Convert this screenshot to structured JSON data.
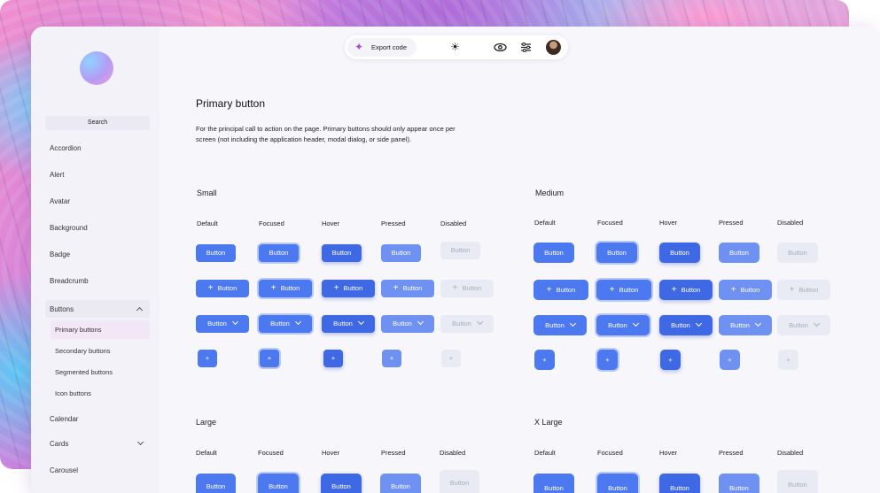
{
  "toolbar": {
    "export_label": "Export code",
    "icons": [
      "sparkle-icon",
      "sun-icon",
      "eye-icon",
      "sliders-icon",
      "avatar"
    ]
  },
  "sidebar": {
    "search_label": "Search",
    "items": [
      "Accordion",
      "Alert",
      "Avatar",
      "Background",
      "Badge",
      "Breadcrumb"
    ],
    "group_label": "Buttons",
    "sub_items": [
      "Primary buttons",
      "Secondary buttons",
      "Segmented buttons",
      "Icon buttons"
    ],
    "after_items": [
      "Calendar",
      "Cards",
      "Carousel"
    ]
  },
  "main": {
    "title": "Primary button",
    "description": "For the principal call to action on the page. Primary buttons should only appear once per screen (not including the application header, modal dialog, or side panel).",
    "states": [
      "Default",
      "Focused",
      "Hover",
      "Pressed",
      "Disabled"
    ],
    "sections": {
      "small": "Small",
      "medium": "Medium",
      "large": "Large",
      "xlarge": "X Large"
    },
    "button_label": "Button",
    "plus_glyph": "+"
  },
  "colors": {
    "primary": "#4c79ef",
    "hover": "#3f69e4",
    "pressed": "#6f92f2",
    "disabled_bg": "#e8ebf4",
    "disabled_text": "#a9adbd",
    "focus_ring": "#b8c9fb"
  }
}
